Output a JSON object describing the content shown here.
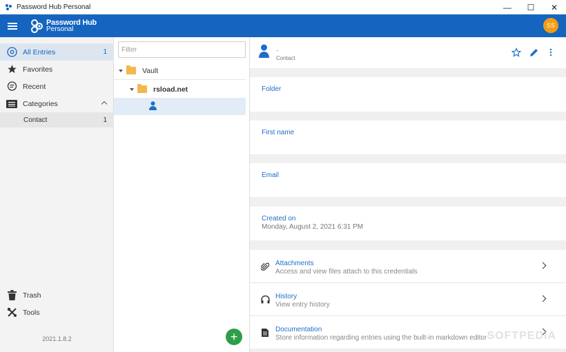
{
  "window": {
    "title": "Password Hub Personal",
    "minimize": "—",
    "maximize": "☐",
    "close": "✕"
  },
  "header": {
    "logo_line1": "Password Hub",
    "logo_line2": "Personal",
    "avatar_initials": "SS",
    "bar_color": "#1565c0",
    "avatar_color": "#f39c12"
  },
  "sidebar": {
    "items": [
      {
        "label": "All Entries",
        "count": "1",
        "icon": "all-entries-icon"
      },
      {
        "label": "Favorites",
        "icon": "star-icon"
      },
      {
        "label": "Recent",
        "icon": "recent-icon"
      },
      {
        "label": "Categories",
        "icon": "list-icon"
      }
    ],
    "sub_items": [
      {
        "label": "Contact",
        "count": "1"
      }
    ],
    "bottom_items": [
      {
        "label": "Trash",
        "icon": "trash-icon"
      },
      {
        "label": "Tools",
        "icon": "tools-icon"
      }
    ],
    "version": "2021.1.8.2"
  },
  "middle": {
    "filter_placeholder": "Filter",
    "tree": [
      {
        "label": "Vault",
        "type": "folder"
      },
      {
        "label": "rsload.net",
        "type": "folder"
      },
      {
        "label": "",
        "type": "contact"
      }
    ],
    "add_label": "+"
  },
  "detail": {
    "entry_name": "·",
    "entry_type": "Contact",
    "fields": [
      {
        "label": "Folder",
        "value": ""
      },
      {
        "label": "First name",
        "value": ""
      },
      {
        "label": "Email",
        "value": ""
      },
      {
        "label": "Created on",
        "value": "Monday, August 2, 2021 6:31 PM"
      }
    ],
    "links": [
      {
        "title": "Attachments",
        "subtitle": "Access and view files attach to this credentials",
        "icon": "paperclip-icon"
      },
      {
        "title": "History",
        "subtitle": "View entry history",
        "icon": "history-icon"
      },
      {
        "title": "Documentation",
        "subtitle": "Store information regarding entries using the built-in markdown editor",
        "icon": "document-icon"
      }
    ],
    "accent_color": "#1e6ec8"
  },
  "watermark": "SOFTPEDIA"
}
